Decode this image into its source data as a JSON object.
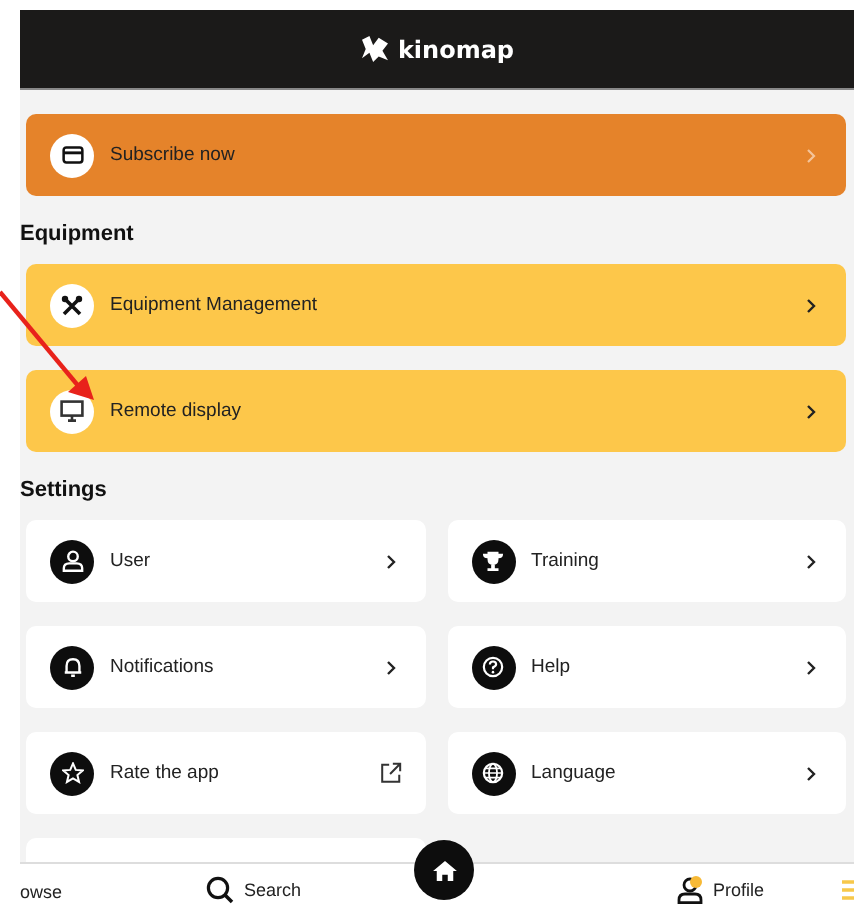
{
  "header": {
    "logo_text": "kinomap"
  },
  "subscribe": {
    "label": "Subscribe now"
  },
  "sections": [
    {
      "title": "Equipment",
      "kind": "list",
      "items": [
        {
          "label": "Equipment Management",
          "kind": "arrow"
        },
        {
          "label": "Remote display",
          "kind": "arrow"
        }
      ]
    },
    {
      "title": "Settings",
      "kind": "grid",
      "items": [
        {
          "label": "User",
          "kind": "arrow"
        },
        {
          "label": "Training",
          "kind": "arrow"
        },
        {
          "label": "Notifications",
          "kind": "arrow"
        },
        {
          "label": "Help",
          "kind": "arrow"
        },
        {
          "label": "Rate the app",
          "kind": "external"
        },
        {
          "label": "Language",
          "kind": "arrow"
        }
      ]
    }
  ],
  "bottom_nav": [
    {
      "label": "owse"
    },
    {
      "label": "Search"
    },
    {
      "label": "Profile"
    }
  ]
}
